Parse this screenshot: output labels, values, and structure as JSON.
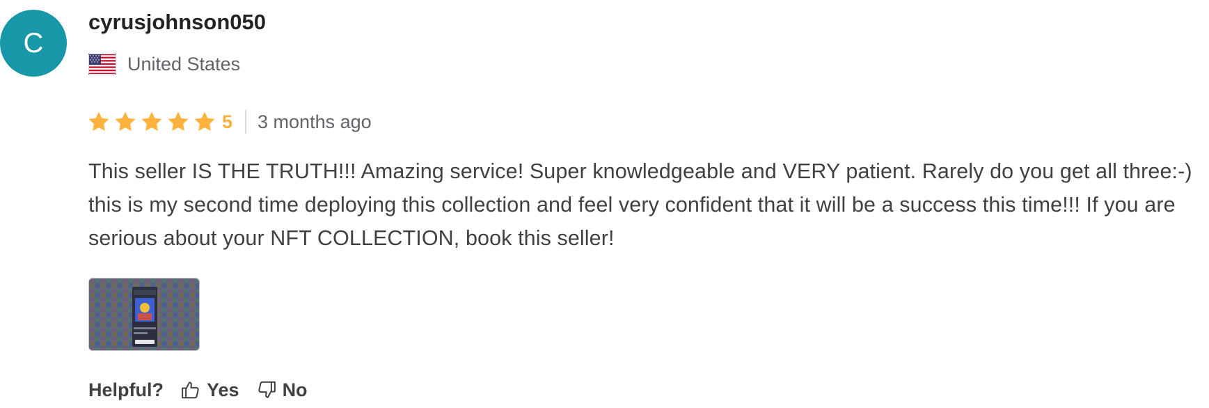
{
  "review": {
    "avatar_initial": "C",
    "avatar_color": "#1797a8",
    "username": "cyrusjohnson050",
    "country": "United States",
    "country_flag_icon": "us-flag-icon",
    "rating": 5,
    "rating_label": "5",
    "star_color": "#ffb33e",
    "time_ago": "3 months ago",
    "text": "This seller IS THE TRUTH!!! Amazing service! Super knowledgeable and VERY patient. Rarely do you get all three:-) this is my second time deploying this collection and feel very confident that it will be a success this time!!! If you are serious about your NFT COLLECTION, book this seller!",
    "attachment_icon": "review-attachment-thumbnail"
  },
  "helpful": {
    "label": "Helpful?",
    "yes_label": "Yes",
    "yes_icon": "thumbs-up-icon",
    "no_label": "No",
    "no_icon": "thumbs-down-icon"
  }
}
